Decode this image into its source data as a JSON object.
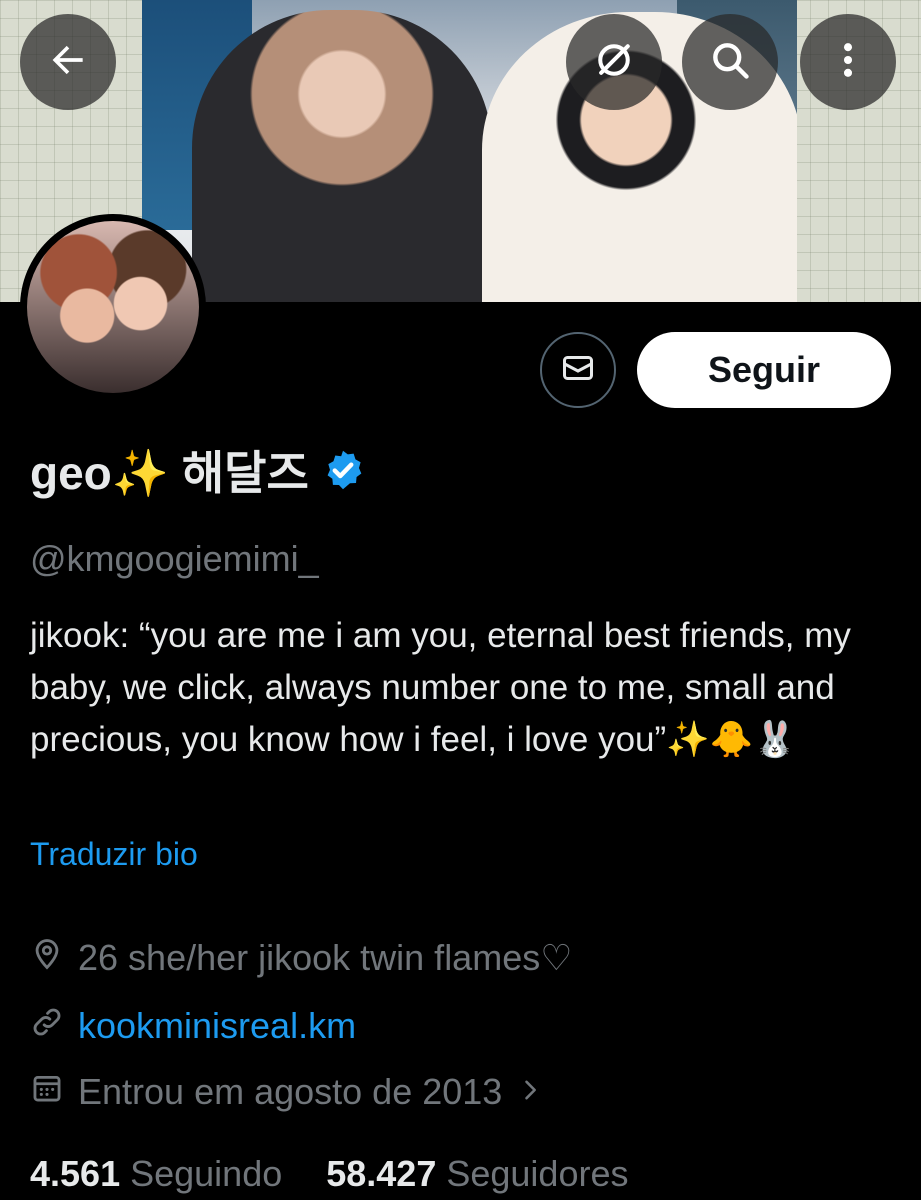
{
  "header": {
    "back_icon": "arrow-left-icon",
    "grok_icon": "grok-icon",
    "search_icon": "search-icon",
    "more_icon": "more-vertical-icon"
  },
  "profile": {
    "display_name": "geo✨ 해달즈",
    "verified": true,
    "handle": "@kmgoogiemimi_",
    "bio": "jikook: “you are me i am you, eternal best friends, my baby, we click, always number one to me, small and precious, you know how i feel, i love you”✨🐥🐰",
    "translate_label": "Traduzir bio",
    "location": "26 she/her jikook twin flames♡",
    "website": "kookminisreal.km",
    "joined": "Entrou em agosto de 2013",
    "following_count": "4.561",
    "following_label": "Seguindo",
    "followers_count": "58.427",
    "followers_label": "Seguidores"
  },
  "actions": {
    "message_icon": "mail-icon",
    "follow_label": "Seguir"
  },
  "colors": {
    "background": "#000000",
    "text_primary": "#e7e9ea",
    "text_secondary": "#71767b",
    "link": "#1d9bf0",
    "verified_badge": "#1d9bf0"
  }
}
